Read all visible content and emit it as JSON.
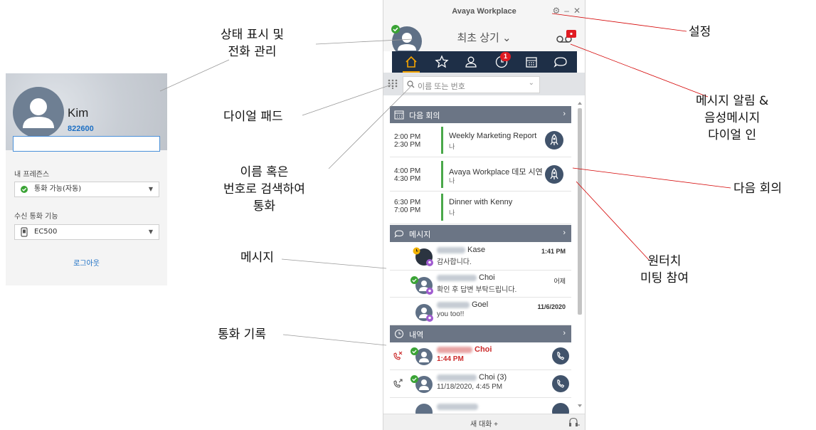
{
  "callouts": {
    "status": [
      "상태 표시 및",
      "전화 관리"
    ],
    "dialpad": "다이얼 패드",
    "search": [
      "이름 혹은",
      "번호로 검색하여",
      "통화"
    ],
    "messages": "메시지",
    "history": "통화 기록",
    "settings": "설정",
    "voicemail": [
      "메시지 알림 &",
      "음성메시지",
      "다이얼 인"
    ],
    "next_meeting": "다음 회의",
    "one_touch": [
      "원터치",
      "미팅 참여"
    ]
  },
  "profile": {
    "name": "Kim",
    "extension": "822600",
    "presence_label": "내 프레즌스",
    "presence_value": "통화 가능(자동)",
    "incoming_label": "수신 통화 기능",
    "incoming_value": "EC500",
    "logout": "로그아웃"
  },
  "app": {
    "title": "Avaya Workplace",
    "status_title": "최초 상기 ⌄",
    "tabs_badge": "1",
    "search_placeholder": "이름 또는 번호",
    "sections": {
      "meetings": "다음 회의",
      "messages": "메시지",
      "history": "내역"
    },
    "meetings": [
      {
        "start": "2:00 PM",
        "end": "2:30 PM",
        "title": "Weekly Marketing Report",
        "sub": "나"
      },
      {
        "start": "4:00 PM",
        "end": "4:30 PM",
        "title": "Avaya Workplace 데모 시연",
        "sub": "나"
      },
      {
        "start": "6:30 PM",
        "end": "7:00 PM",
        "title": "Dinner with Kenny",
        "sub": "나"
      }
    ],
    "messages": [
      {
        "name": "Kase",
        "snippet": "감사합니다.",
        "time": "1:41 PM"
      },
      {
        "name": "Choi",
        "snippet": "확인 후 답변 부탁드립니다.",
        "time": "어제"
      },
      {
        "name": "Goel",
        "snippet": "you too!!",
        "time": "11/6/2020"
      }
    ],
    "history": [
      {
        "name": "Choi",
        "detail": "1:44 PM"
      },
      {
        "name": "Choi  (3)",
        "detail": "11/18/2020, 4:45 PM"
      }
    ],
    "footer_new_chat": "새 대화 +"
  },
  "colors": {
    "nav": "#1e2f47",
    "section": "#6b7585",
    "accent": "#f4a300",
    "available": "#3aa335",
    "missed": "#cc2b2b",
    "callout_line": "#d40000"
  }
}
